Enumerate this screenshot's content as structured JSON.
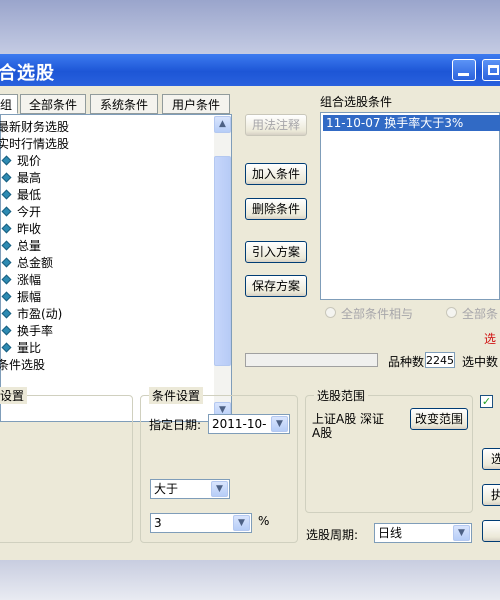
{
  "window": {
    "title": "合选股"
  },
  "tabs": [
    {
      "label": "组",
      "active": true
    },
    {
      "label": "全部条件",
      "active": false
    },
    {
      "label": "系统条件",
      "active": false
    },
    {
      "label": "用户条件",
      "active": false
    }
  ],
  "tree": {
    "items": [
      {
        "label": "最新财务选股",
        "level": 0
      },
      {
        "label": "实时行情选股",
        "level": 0
      },
      {
        "label": "现价",
        "level": 1
      },
      {
        "label": "最高",
        "level": 1
      },
      {
        "label": "最低",
        "level": 1
      },
      {
        "label": "今开",
        "level": 1
      },
      {
        "label": "昨收",
        "level": 1
      },
      {
        "label": "总量",
        "level": 1
      },
      {
        "label": "总金额",
        "level": 1
      },
      {
        "label": "涨幅",
        "level": 1
      },
      {
        "label": "振幅",
        "level": 1
      },
      {
        "label": "市盈(动)",
        "level": 1
      },
      {
        "label": "换手率",
        "level": 1
      },
      {
        "label": "量比",
        "level": 1
      },
      {
        "label": "条件选股",
        "level": 0
      }
    ]
  },
  "actions": {
    "explain": "用法注释",
    "add": "加入条件",
    "delete": "删除条件",
    "import": "引入方案",
    "save": "保存方案"
  },
  "combo": {
    "heading": "组合选股条件",
    "rows": [
      "11-10-07  换手率大于3%"
    ],
    "radio_all_and": "全部条件相与",
    "radio_all_or": "全部条",
    "select_label": "选",
    "count_label": "品种数",
    "count_value": "2245",
    "selected_label": "选中数"
  },
  "settings": {
    "left_group": "设置",
    "cond_group": "条件设置",
    "date_label": "指定日期:",
    "date_value": "2011-10-",
    "operator_value": "大于",
    "threshold_value": "3",
    "unit": "%",
    "range_group": "选股范围",
    "range_text_1": "上证A股 深证",
    "range_text_2": "A股",
    "change_range": "改变范围",
    "period_label": "选股周期:",
    "period_value": "日线",
    "right_btn_1": "选",
    "right_btn_2": "执"
  },
  "colors": {
    "title_bar": "#2961de",
    "selection": "#316ac5",
    "window_bg": "#ece9d8",
    "gem_icon": "#2d8bb3",
    "check": "#21a121"
  }
}
